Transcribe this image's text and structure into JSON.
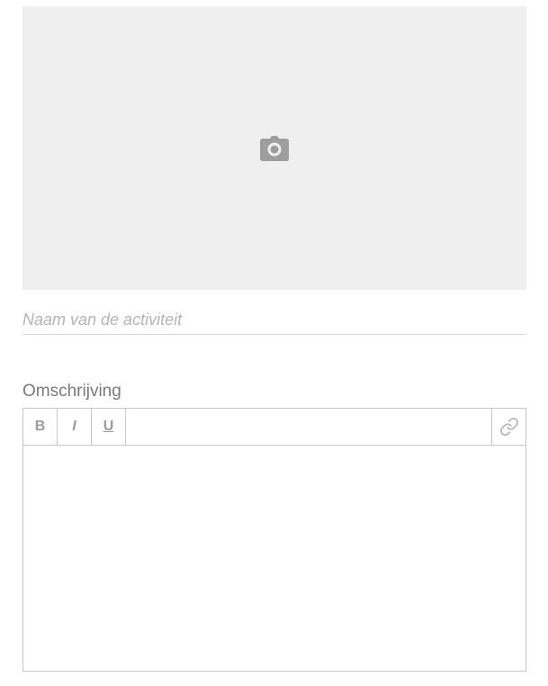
{
  "photo": {
    "icon": "camera-icon",
    "background": "#efefef",
    "icon_color": "#9e9e9e"
  },
  "name_field": {
    "value": "",
    "placeholder": "Naam van de activiteit"
  },
  "description": {
    "label": "Omschrijving",
    "toolbar": {
      "bold": "B",
      "italic": "I",
      "underline": "U",
      "link_icon": "link-icon"
    },
    "content": ""
  }
}
